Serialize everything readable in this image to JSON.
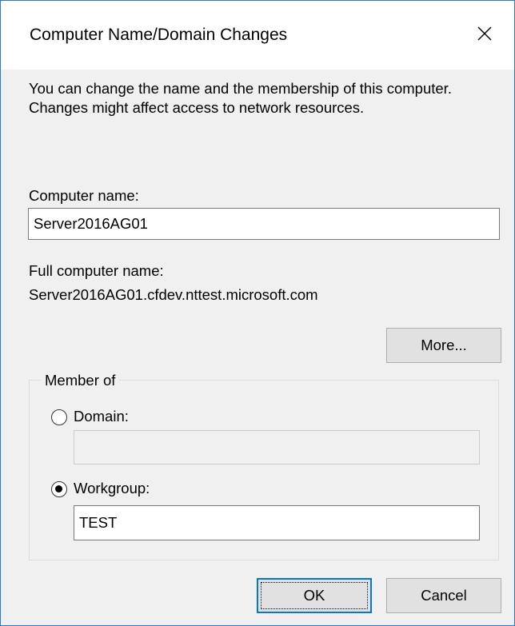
{
  "window": {
    "title": "Computer Name/Domain Changes",
    "close_glyph": "✕"
  },
  "description": "You can change the name and the membership of this computer. Changes might affect access to network resources.",
  "computer_name": {
    "label": "Computer name:",
    "value": "Server2016AG01"
  },
  "full_name": {
    "label": "Full computer name:",
    "value": "Server2016AG01.cfdev.nttest.microsoft.com"
  },
  "more_button": "More...",
  "member_of": {
    "label": "Member of",
    "domain": {
      "label": "Domain:",
      "selected": false,
      "value": ""
    },
    "workgroup": {
      "label": "Workgroup:",
      "selected": true,
      "value": "TEST"
    }
  },
  "buttons": {
    "ok": "OK",
    "cancel": "Cancel"
  },
  "colors": {
    "window_border": "#2b79d6",
    "focus_accent": "#0078d7"
  }
}
